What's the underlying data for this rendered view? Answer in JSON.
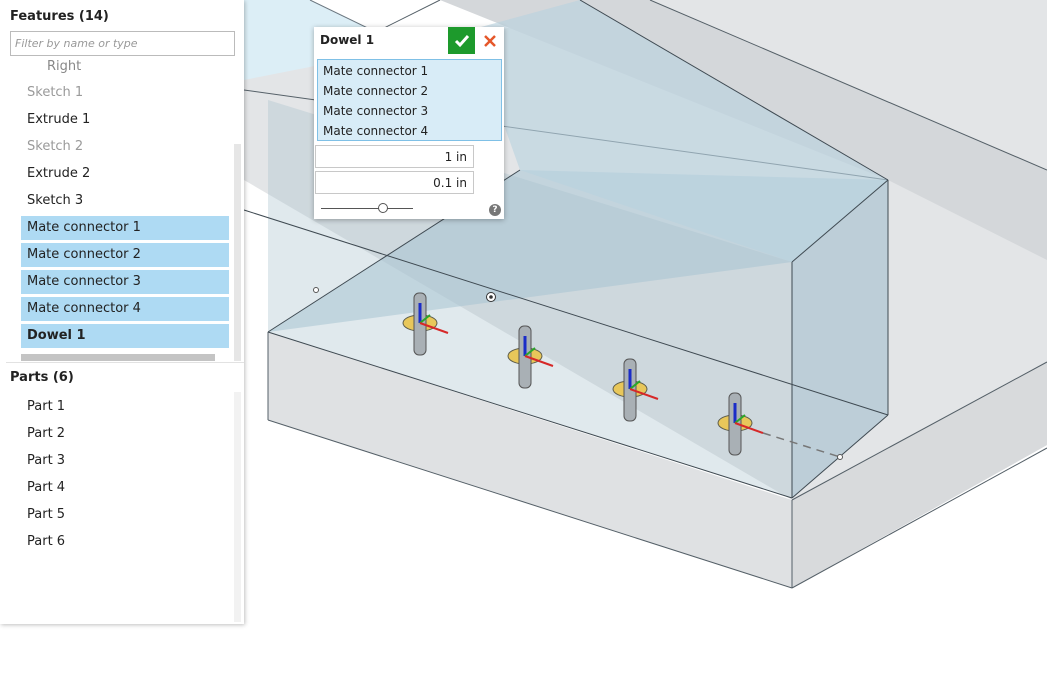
{
  "features": {
    "title": "Features (14)",
    "filter_placeholder": "Filter by name or type",
    "items": [
      {
        "label": "Right",
        "state": "partial"
      },
      {
        "label": "Sketch 1",
        "state": "suppressed"
      },
      {
        "label": "Extrude 1",
        "state": "normal"
      },
      {
        "label": "Sketch 2",
        "state": "suppressed"
      },
      {
        "label": "Extrude 2",
        "state": "normal"
      },
      {
        "label": "Sketch 3",
        "state": "normal"
      },
      {
        "label": "Mate connector 1",
        "state": "selected"
      },
      {
        "label": "Mate connector 2",
        "state": "selected"
      },
      {
        "label": "Mate connector 3",
        "state": "selected"
      },
      {
        "label": "Mate connector 4",
        "state": "selected"
      },
      {
        "label": "Dowel 1",
        "state": "selected-active"
      }
    ]
  },
  "parts": {
    "title": "Parts (6)",
    "items": [
      "Part 1",
      "Part 2",
      "Part 3",
      "Part 4",
      "Part 5",
      "Part 6"
    ]
  },
  "dialog": {
    "title": "Dowel 1",
    "selections": [
      "Mate connector 1",
      "Mate connector 2",
      "Mate connector 3",
      "Mate connector 4"
    ],
    "diameter": "1 in",
    "offset": "0.1 in",
    "slider_value": 0.62
  },
  "colors": {
    "accent_green": "#1d9a2c",
    "cancel_red": "#e5572a",
    "selection_blue": "#aedaf3"
  }
}
